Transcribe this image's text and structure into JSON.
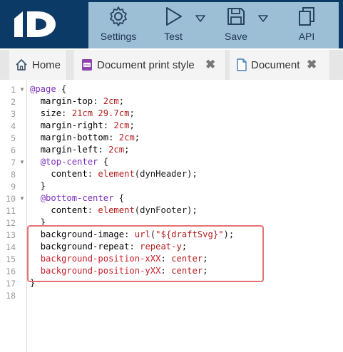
{
  "toolbar": {
    "settings_label": "Settings",
    "test_label": "Test",
    "save_label": "Save",
    "api_label": "API"
  },
  "tabs": [
    {
      "label": "Home"
    },
    {
      "label": "Document print style",
      "close": "✖"
    },
    {
      "label": "Document",
      "close": "✖"
    }
  ],
  "editor": {
    "line_numbers": [
      "1",
      "2",
      "3",
      "4",
      "5",
      "6",
      "7",
      "8",
      "9",
      "10",
      "11",
      "12",
      "13",
      "14",
      "15",
      "16",
      "17",
      "18"
    ],
    "lines": [
      "@page {",
      "  margin-top: 2cm;",
      "  size: 21cm 29.7cm;",
      "  margin-right: 2cm;",
      "  margin-bottom: 2cm;",
      "  margin-left: 2cm;",
      "  @top-center {",
      "    content: element(dynHeader);",
      "  }",
      "  @bottom-center {",
      "    content: element(dynFooter);",
      "  }",
      "  background-image: url(\"${draftSvg}\");",
      "  background-repeat: repeat-y;",
      "  background-position-xXX: center;",
      "  background-position-yXX: center;",
      "}",
      ""
    ]
  }
}
